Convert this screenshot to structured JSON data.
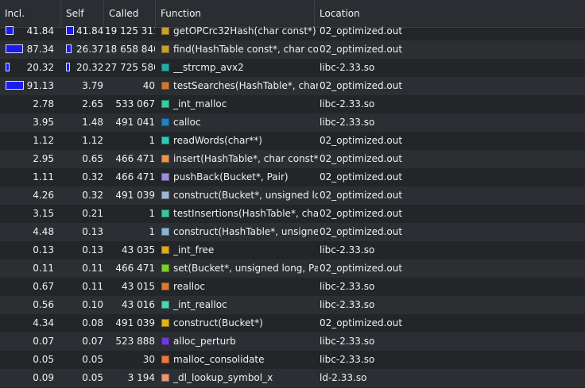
{
  "columns": {
    "incl": "Incl.",
    "self": "Self",
    "called": "Called",
    "function": "Function",
    "location": "Location"
  },
  "rows": [
    {
      "incl": "41.84",
      "self": "41.84",
      "called": "19 125 311",
      "func": "getOPCrc32Hash(char const*)",
      "loc": "02_optimized.out",
      "color": "#c8a032",
      "inclFrac": 0.4184,
      "selfFrac": 0.4184
    },
    {
      "incl": "87.34",
      "self": "26.37",
      "called": "18 658 840",
      "func": "find(HashTable const*, char con...",
      "loc": "02_optimized.out",
      "color": "#c8a032",
      "inclFrac": 0.8734,
      "selfFrac": 0.2637
    },
    {
      "incl": "20.32",
      "self": "20.32",
      "called": "27 725 580",
      "func": "__strcmp_avx2",
      "loc": "libc-2.33.so",
      "color": "#2aa8a8",
      "inclFrac": 0.2032,
      "selfFrac": 0.2032
    },
    {
      "incl": "91.13",
      "self": "3.79",
      "called": "40",
      "func": "testSearches(HashTable*, char ...",
      "loc": "02_optimized.out",
      "color": "#d2782e",
      "inclFrac": 0.9113,
      "selfFrac": 0.0379
    },
    {
      "incl": "2.78",
      "self": "2.65",
      "called": "533 067",
      "func": "_int_malloc",
      "loc": "libc-2.33.so",
      "color": "#3cc8a0",
      "inclFrac": 0.0278,
      "selfFrac": 0.0265
    },
    {
      "incl": "3.95",
      "self": "1.48",
      "called": "491 041",
      "func": "calloc",
      "loc": "libc-2.33.so",
      "color": "#1e82c8",
      "inclFrac": 0.0395,
      "selfFrac": 0.0148
    },
    {
      "incl": "1.12",
      "self": "1.12",
      "called": "1",
      "func": "readWords(char**)",
      "loc": "02_optimized.out",
      "color": "#32c8b4",
      "inclFrac": 0.0112,
      "selfFrac": 0.0112
    },
    {
      "incl": "2.95",
      "self": "0.65",
      "called": "466 471",
      "func": "insert(HashTable*, char const*, ...",
      "loc": "02_optimized.out",
      "color": "#e69650",
      "inclFrac": 0.0295,
      "selfFrac": 0.0065
    },
    {
      "incl": "1.11",
      "self": "0.32",
      "called": "466 471",
      "func": "pushBack(Bucket*, Pair)",
      "loc": "02_optimized.out",
      "color": "#a08cdc",
      "inclFrac": 0.0111,
      "selfFrac": 0.0032
    },
    {
      "incl": "4.26",
      "self": "0.32",
      "called": "491 039",
      "func": "construct(Bucket*, unsigned long)",
      "loc": "02_optimized.out",
      "color": "#a0b4d2",
      "inclFrac": 0.0426,
      "selfFrac": 0.0032
    },
    {
      "incl": "3.15",
      "self": "0.21",
      "called": "1",
      "func": "testInsertions(HashTable*, char...",
      "loc": "02_optimized.out",
      "color": "#3cc896",
      "inclFrac": 0.0315,
      "selfFrac": 0.0021
    },
    {
      "incl": "4.48",
      "self": "0.13",
      "called": "1",
      "func": "construct(HashTable*, unsigne...",
      "loc": "02_optimized.out",
      "color": "#8cb4d2",
      "inclFrac": 0.0448,
      "selfFrac": 0.0013
    },
    {
      "incl": "0.13",
      "self": "0.13",
      "called": "43 035",
      "func": "_int_free",
      "loc": "libc-2.33.so",
      "color": "#dcaa1e",
      "inclFrac": 0.0013,
      "selfFrac": 0.0013
    },
    {
      "incl": "0.11",
      "self": "0.11",
      "called": "466 471",
      "func": "set(Bucket*, unsigned long, Pair)",
      "loc": "02_optimized.out",
      "color": "#78d228",
      "inclFrac": 0.0011,
      "selfFrac": 0.0011
    },
    {
      "incl": "0.67",
      "self": "0.11",
      "called": "43 015",
      "func": "realloc",
      "loc": "libc-2.33.so",
      "color": "#dc7832",
      "inclFrac": 0.0067,
      "selfFrac": 0.0011
    },
    {
      "incl": "0.56",
      "self": "0.10",
      "called": "43 016",
      "func": "_int_realloc",
      "loc": "libc-2.33.so",
      "color": "#50d2b4",
      "inclFrac": 0.0056,
      "selfFrac": 0.001
    },
    {
      "incl": "4.34",
      "self": "0.08",
      "called": "491 039",
      "func": "construct(Bucket*)",
      "loc": "02_optimized.out",
      "color": "#dcb41e",
      "inclFrac": 0.0434,
      "selfFrac": 0.0008
    },
    {
      "incl": "0.07",
      "self": "0.07",
      "called": "523 888",
      "func": "alloc_perturb",
      "loc": "libc-2.33.so",
      "color": "#6e3cdc",
      "inclFrac": 0.0007,
      "selfFrac": 0.0007
    },
    {
      "incl": "0.05",
      "self": "0.05",
      "called": "30",
      "func": "malloc_consolidate",
      "loc": "libc-2.33.so",
      "color": "#e6783c",
      "inclFrac": 0.0005,
      "selfFrac": 0.0005
    },
    {
      "incl": "0.09",
      "self": "0.05",
      "called": "3 194",
      "func": "_dl_lookup_symbol_x",
      "loc": "ld-2.33.so",
      "color": "#e69678",
      "inclFrac": 0.0009,
      "selfFrac": 0.0005
    }
  ]
}
